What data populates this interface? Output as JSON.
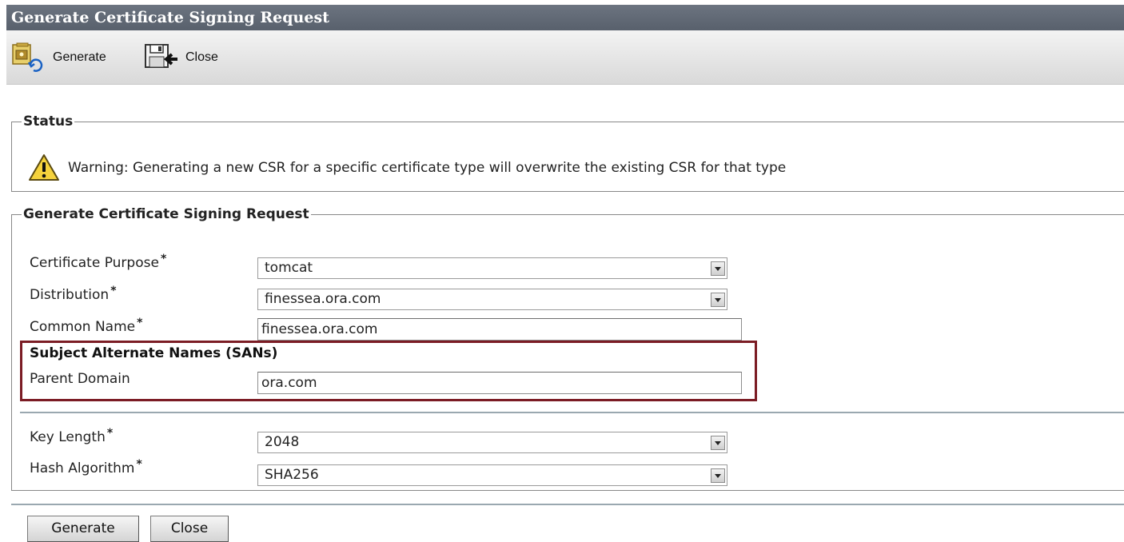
{
  "window": {
    "title": "Generate Certificate Signing Request"
  },
  "toolbar": {
    "generate_label": "Generate",
    "close_label": "Close",
    "generate_icon": "certificate-generate-icon",
    "close_icon": "save-close-icon"
  },
  "status": {
    "legend": "Status",
    "warning_icon": "warning-icon",
    "message": "Warning: Generating a new CSR for a specific certificate type will overwrite the existing CSR for that type"
  },
  "csr": {
    "legend": "Generate Certificate Signing Request",
    "fields": {
      "certificate_purpose": {
        "label": "Certificate Purpose",
        "required": "*",
        "value": "tomcat"
      },
      "distribution": {
        "label": "Distribution",
        "required": "*",
        "value": "finessea.ora.com"
      },
      "common_name": {
        "label": "Common Name",
        "required": "*",
        "value": "finessea.ora.com"
      },
      "san_heading": "Subject Alternate Names (SANs)",
      "parent_domain": {
        "label": "Parent Domain",
        "value": "ora.com"
      },
      "key_length": {
        "label": "Key Length",
        "required": "*",
        "value": "2048"
      },
      "hash_algorithm": {
        "label": "Hash Algorithm",
        "required": "*",
        "value": "SHA256"
      }
    },
    "highlight_color": "#7b1c24"
  },
  "footer": {
    "generate_label": "Generate",
    "close_label": "Close"
  }
}
